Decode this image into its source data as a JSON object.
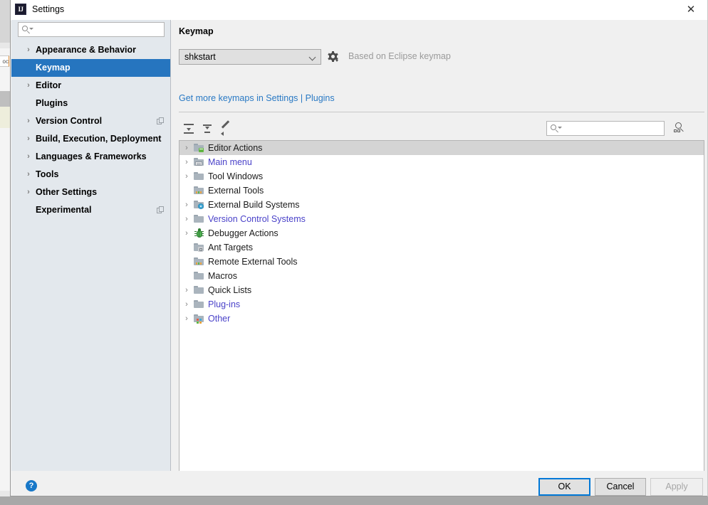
{
  "window": {
    "title": "Settings",
    "app_icon": "IJ",
    "close_label": "✕"
  },
  "sidebar": {
    "search_placeholder": "",
    "search_value": "",
    "search_icon": "search-icon",
    "items": [
      {
        "label": "Appearance & Behavior",
        "arrow": "›",
        "has_arrow": true,
        "selected": false,
        "copy_icon": false
      },
      {
        "label": "Keymap",
        "arrow": "",
        "has_arrow": false,
        "selected": true,
        "copy_icon": false
      },
      {
        "label": "Editor",
        "arrow": "›",
        "has_arrow": true,
        "selected": false,
        "copy_icon": false
      },
      {
        "label": "Plugins",
        "arrow": "",
        "has_arrow": false,
        "selected": false,
        "copy_icon": false
      },
      {
        "label": "Version Control",
        "arrow": "›",
        "has_arrow": true,
        "selected": false,
        "copy_icon": true
      },
      {
        "label": "Build, Execution, Deployment",
        "arrow": "›",
        "has_arrow": true,
        "selected": false,
        "copy_icon": false
      },
      {
        "label": "Languages & Frameworks",
        "arrow": "›",
        "has_arrow": true,
        "selected": false,
        "copy_icon": false
      },
      {
        "label": "Tools",
        "arrow": "›",
        "has_arrow": true,
        "selected": false,
        "copy_icon": false
      },
      {
        "label": "Other Settings",
        "arrow": "›",
        "has_arrow": true,
        "selected": false,
        "copy_icon": false
      },
      {
        "label": "Experimental",
        "arrow": "",
        "has_arrow": false,
        "selected": false,
        "copy_icon": true
      }
    ]
  },
  "main": {
    "title": "Keymap",
    "keymap_select": {
      "value": "shkstart",
      "options": [
        "shkstart"
      ]
    },
    "gear_icon": "gear-icon",
    "based_on_text": "Based on Eclipse keymap",
    "get_more_link": "Get more keymaps in Settings | Plugins",
    "toolbar": {
      "expand_all_icon": "expand-all-icon",
      "collapse_all_icon": "collapse-all-icon",
      "edit_icon": "pencil-icon",
      "search_placeholder": "",
      "search_value": "",
      "search_icon": "search-icon",
      "shortcut_filter_icon": "find-by-shortcut-icon"
    },
    "tree": [
      {
        "label": "Editor Actions",
        "arrow": "›",
        "has_arrow": true,
        "selected": true,
        "link": false,
        "icon": "folder-green-code-icon"
      },
      {
        "label": "Main menu",
        "arrow": "›",
        "has_arrow": true,
        "selected": false,
        "link": true,
        "icon": "folder-menu-icon"
      },
      {
        "label": "Tool Windows",
        "arrow": "›",
        "has_arrow": true,
        "selected": false,
        "link": false,
        "icon": "folder-icon"
      },
      {
        "label": "External Tools",
        "arrow": "",
        "has_arrow": false,
        "selected": false,
        "link": false,
        "icon": "folder-dots-icon"
      },
      {
        "label": "External Build Systems",
        "arrow": "›",
        "has_arrow": true,
        "selected": false,
        "link": false,
        "icon": "folder-cog-icon"
      },
      {
        "label": "Version Control Systems",
        "arrow": "›",
        "has_arrow": true,
        "selected": false,
        "link": true,
        "icon": "folder-icon"
      },
      {
        "label": "Debugger Actions",
        "arrow": "›",
        "has_arrow": true,
        "selected": false,
        "link": false,
        "icon": "bug-icon"
      },
      {
        "label": "Ant Targets",
        "arrow": "",
        "has_arrow": false,
        "selected": false,
        "link": false,
        "icon": "folder-ant-icon"
      },
      {
        "label": "Remote External Tools",
        "arrow": "",
        "has_arrow": false,
        "selected": false,
        "link": false,
        "icon": "folder-dots-icon"
      },
      {
        "label": "Macros",
        "arrow": "",
        "has_arrow": false,
        "selected": false,
        "link": false,
        "icon": "folder-icon"
      },
      {
        "label": "Quick Lists",
        "arrow": "›",
        "has_arrow": true,
        "selected": false,
        "link": false,
        "icon": "folder-icon"
      },
      {
        "label": "Plug-ins",
        "arrow": "›",
        "has_arrow": true,
        "selected": false,
        "link": true,
        "icon": "folder-icon"
      },
      {
        "label": "Other",
        "arrow": "›",
        "has_arrow": true,
        "selected": false,
        "link": true,
        "icon": "folder-multi-icon"
      }
    ]
  },
  "footer": {
    "help_label": "?",
    "ok_label": "OK",
    "cancel_label": "Cancel",
    "apply_label": "Apply"
  },
  "colors": {
    "selection_blue": "#2675bf",
    "link_blue": "#2979c4",
    "tree_link": "#4a42c9",
    "focus_blue": "#0078d7",
    "sidebar_bg": "#e3e8ed",
    "panel_bg": "#f0f0f0"
  }
}
